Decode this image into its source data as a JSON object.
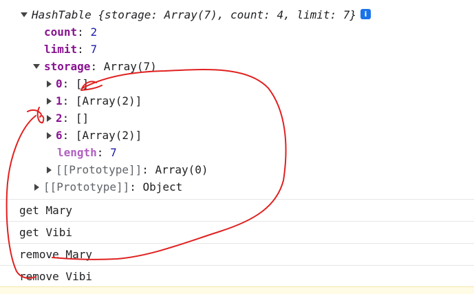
{
  "console": {
    "object": {
      "class_name": "HashTable",
      "summary_open": "{",
      "summary_storage": "storage: Array(7)",
      "summary_count": "count: 4",
      "summary_limit": "limit: 7",
      "summary_close": "}",
      "count_key": "count",
      "count_value": "2",
      "limit_key": "limit",
      "limit_value": "7",
      "storage_key": "storage",
      "storage_value": "Array(7)",
      "entries": [
        {
          "key": "0",
          "value": "[]"
        },
        {
          "key": "1",
          "value": "[Array(2)]"
        },
        {
          "key": "2",
          "value": "[]"
        },
        {
          "key": "6",
          "value": "[Array(2)]"
        }
      ],
      "length_key": "length",
      "length_value": "7",
      "array_proto_key": "[[Prototype]]",
      "array_proto_value": "Array(0)",
      "object_proto_key": "[[Prototype]]",
      "object_proto_value": "Object"
    },
    "logs": [
      "get Mary",
      "get Vibi",
      "remove Mary",
      "remove Vibi"
    ]
  },
  "icons": [
    "expand-triangle-icon",
    "collapse-triangle-icon",
    "info-icon"
  ],
  "colors": {
    "key": "#881391",
    "number": "#1a1aa6",
    "annotation": "#e0201f",
    "info_icon": "#1a73e8"
  }
}
